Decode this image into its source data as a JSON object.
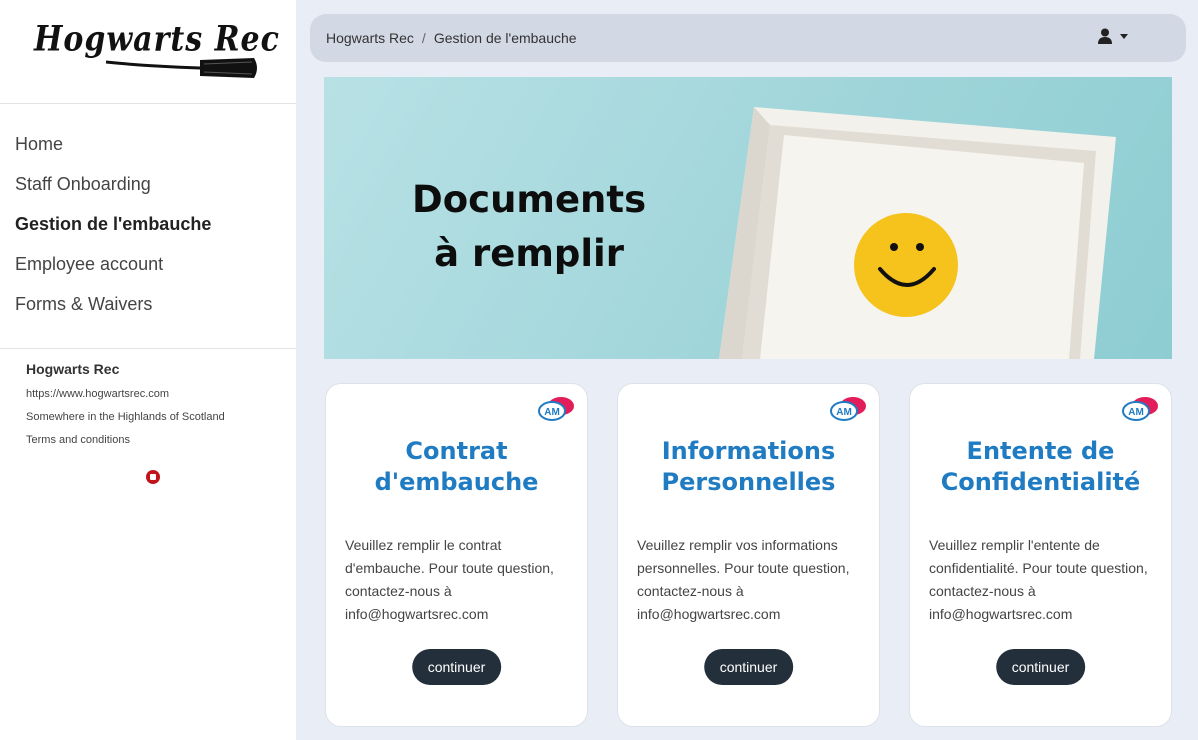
{
  "logo": {
    "text": "Hogwarts Rec"
  },
  "sidebar": {
    "items": [
      {
        "label": "Home"
      },
      {
        "label": "Staff Onboarding"
      },
      {
        "label": "Gestion de l'embauche"
      },
      {
        "label": "Employee account"
      },
      {
        "label": "Forms & Waivers"
      }
    ],
    "active_index": 2
  },
  "company": {
    "name": "Hogwarts Rec",
    "url": "https://www.hogwartsrec.com",
    "address": "Somewhere in the Highlands of Scotland",
    "terms": "Terms and conditions",
    "social_icon": "youtube-icon"
  },
  "breadcrumb": {
    "root": "Hogwarts Rec",
    "separator": "/",
    "current": "Gestion de l'embauche"
  },
  "banner": {
    "line1": "Documents",
    "line2": "à remplir"
  },
  "cards": [
    {
      "title_line1": "Contrat",
      "title_line2": "d'embauche",
      "description": "Veuillez remplir le contrat d'embauche. Pour toute question, contactez-nous à info@hogwartsrec.com",
      "button_label": "continuer"
    },
    {
      "title_line1": "Informations",
      "title_line2": "Personnelles",
      "description": "Veuillez remplir vos informations personnelles. Pour toute question, contactez-nous à info@hogwartsrec.com",
      "button_label": "continuer"
    },
    {
      "title_line1": "Entente de",
      "title_line2": "Confidentialité",
      "description": "Veuillez remplir l'entente de confidentialité. Pour toute question, contactez-nous à info@hogwartsrec.com",
      "button_label": "continuer"
    }
  ],
  "card_badge_text": "AM",
  "colors": {
    "accent_title": "#1f7bc2",
    "button_bg": "#23303b",
    "page_bg": "#e9edf5",
    "topbar_bg": "#d2d8e4"
  }
}
